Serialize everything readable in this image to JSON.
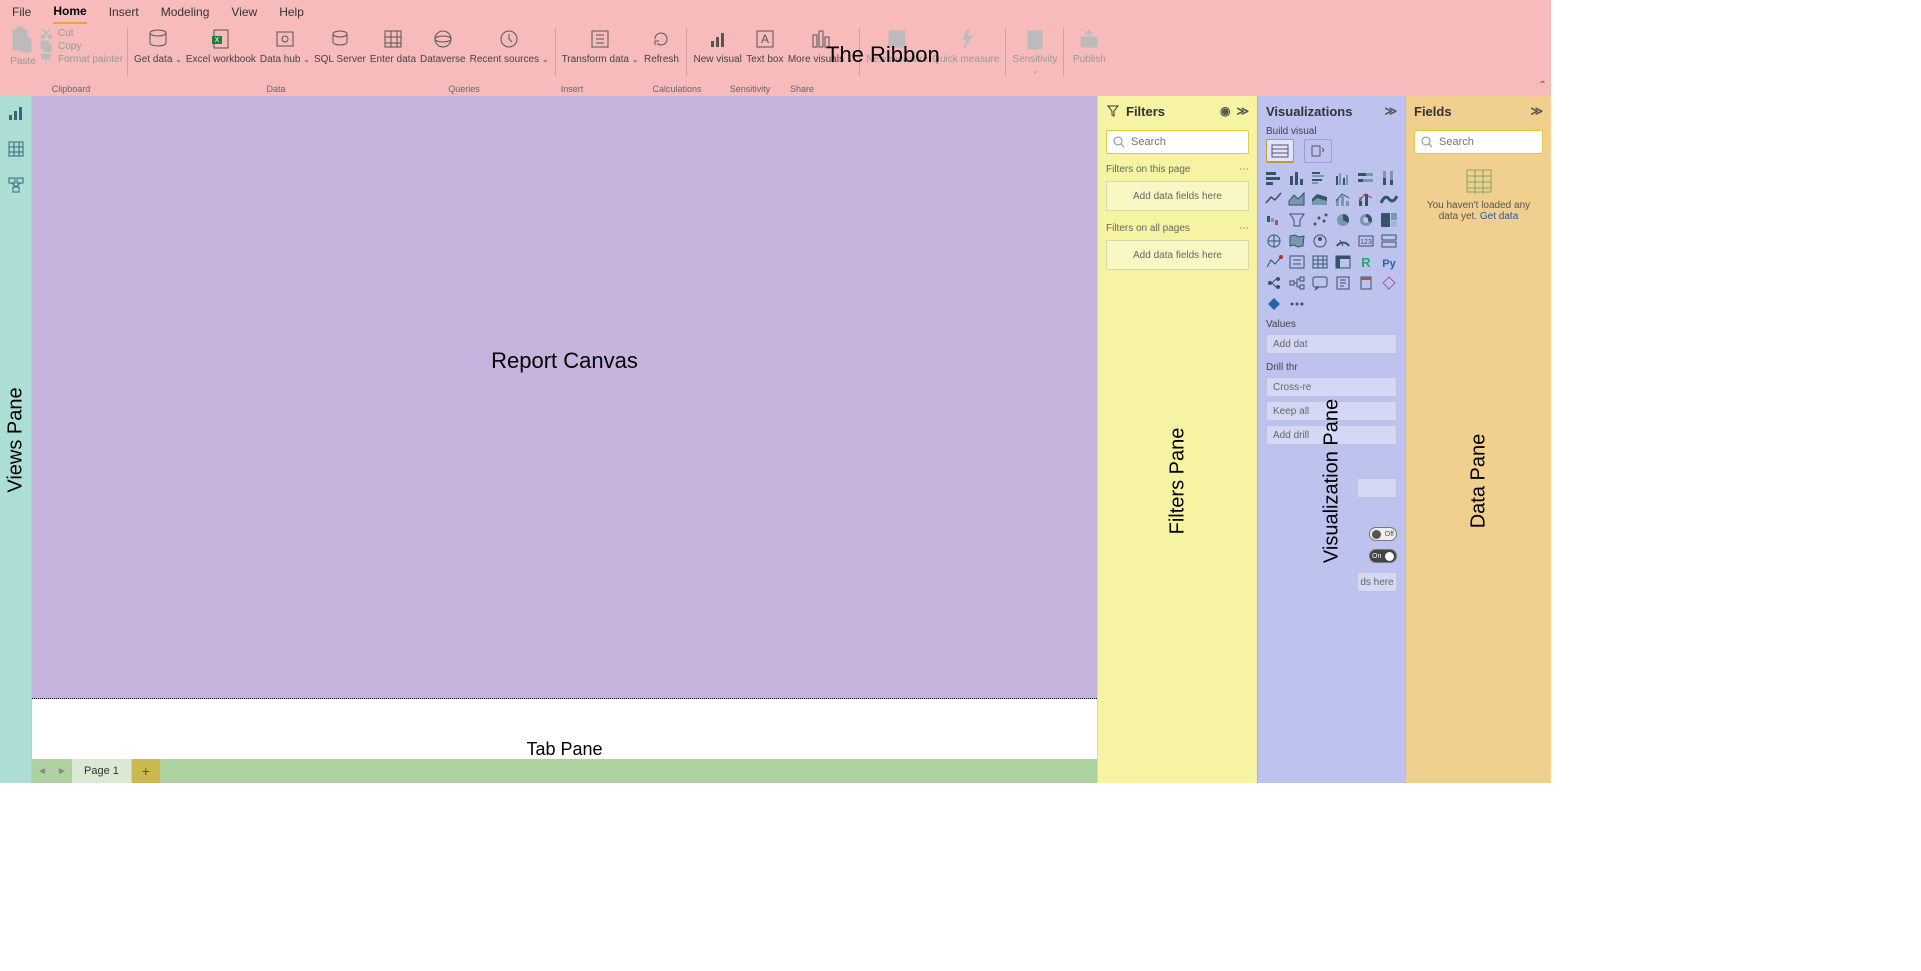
{
  "ribbon": {
    "tabs": [
      "File",
      "Home",
      "Insert",
      "Modeling",
      "View",
      "Help"
    ],
    "active_tab": "Home",
    "annotation": "The Ribbon",
    "clipboard": {
      "paste": "Paste",
      "cut": "Cut",
      "copy": "Copy",
      "format_painter": "Format painter",
      "group_label": "Clipboard"
    },
    "buttons": {
      "get_data": "Get data",
      "excel_workbook": "Excel workbook",
      "data_hub": "Data hub",
      "sql_server": "SQL Server",
      "enter_data": "Enter data",
      "dataverse": "Dataverse",
      "recent_sources": "Recent sources",
      "transform_data": "Transform data",
      "refresh": "Refresh",
      "new_visual": "New visual",
      "text_box": "Text box",
      "more_visuals": "More visuals",
      "new_measure": "New measure",
      "quick_measure": "Quick measure",
      "sensitivity": "Sensitivity",
      "publish": "Publish"
    },
    "group_labels": {
      "data": "Data",
      "queries": "Queries",
      "insert": "Insert",
      "calculations": "Calculations",
      "sensitivity": "Sensitivity",
      "share": "Share"
    }
  },
  "views_annotation": "Views Pane",
  "canvas_annotation": "Report Canvas",
  "tabbar": {
    "annotation": "Tab Pane",
    "page": "Page 1"
  },
  "filters": {
    "title": "Filters",
    "search_placeholder": "Search",
    "section_this_page": "Filters on this page",
    "section_all_pages": "Filters on all pages",
    "dropzone": "Add data fields here",
    "annotation": "Filters Pane"
  },
  "viz": {
    "title": "Visualizations",
    "build": "Build visual",
    "values": "Values",
    "add_data_left": "Add dat",
    "drill_left": "Drill thr",
    "cross_left": "Cross-re",
    "keep_left": "Keep all",
    "add_drill_left": "Add drill",
    "add_drill_right": "ds here",
    "toggle_off": "Off",
    "toggle_on": "On",
    "annotation": "Visualization Pane"
  },
  "fields": {
    "title": "Fields",
    "search_placeholder": "Search",
    "msg_a": "You haven't loaded any data yet. ",
    "msg_link": "Get data",
    "annotation": "Data Pane"
  }
}
